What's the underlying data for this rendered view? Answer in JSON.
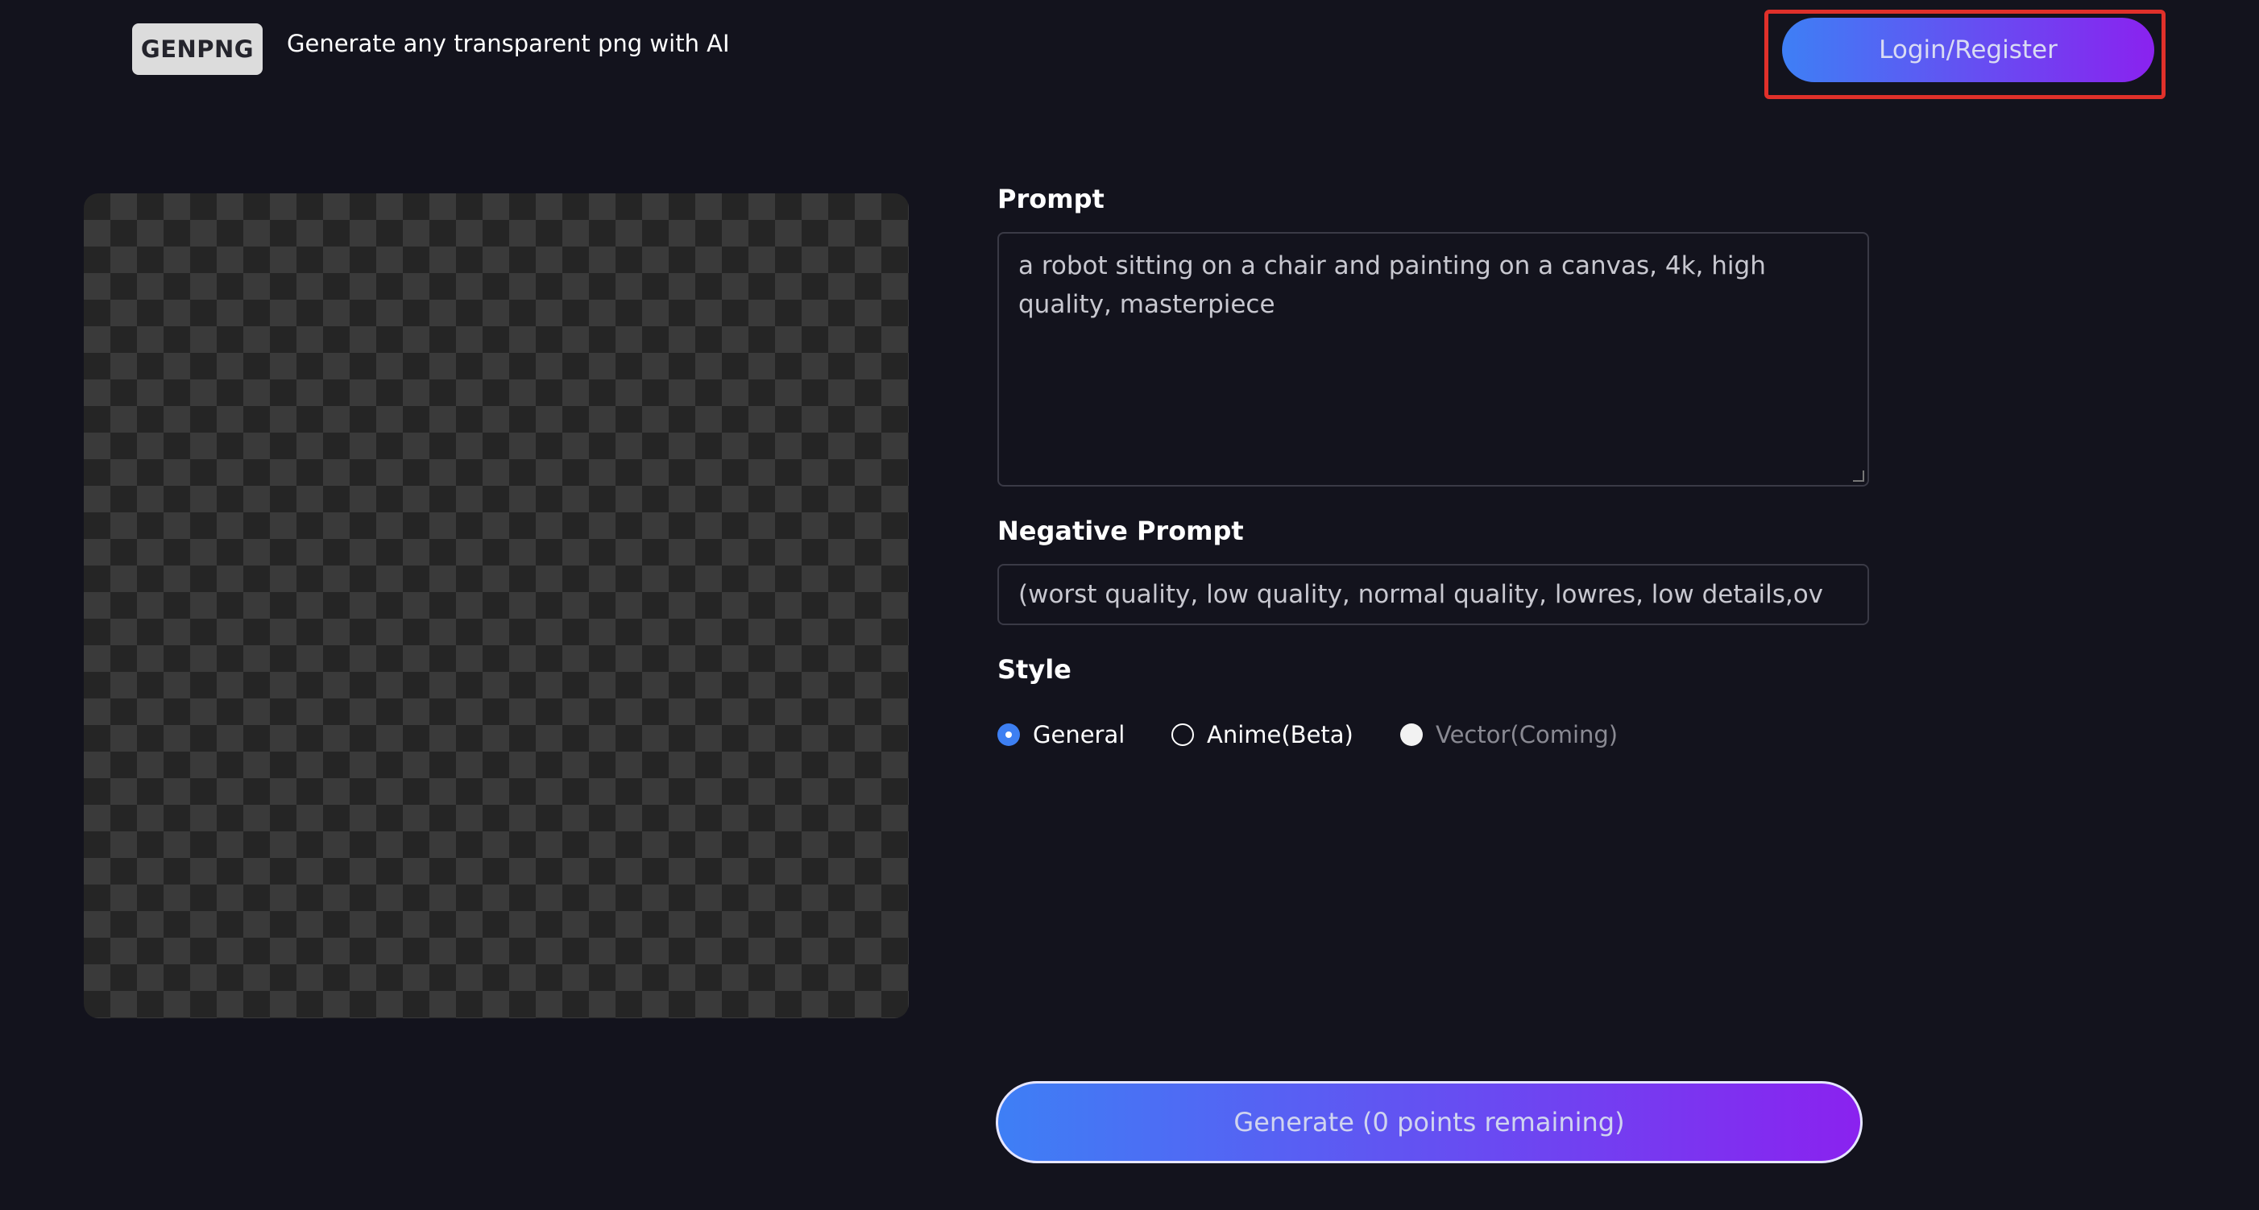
{
  "header": {
    "logo_text": "GENPNG",
    "tagline": "Generate any transparent png with AI",
    "login_label": "Login/Register"
  },
  "preview": {
    "background": "transparent-checkerboard"
  },
  "form": {
    "prompt_label": "Prompt",
    "prompt_value": "a robot sitting on a chair and painting on a canvas, 4k, high quality, masterpiece",
    "negative_label": "Negative Prompt",
    "negative_value": "(worst quality, low quality, normal quality, lowres, low details,ov",
    "style_label": "Style",
    "style_options": [
      {
        "label": "General",
        "selected": true,
        "disabled": false
      },
      {
        "label": "Anime(Beta)",
        "selected": false,
        "disabled": false
      },
      {
        "label": "Vector(Coming)",
        "selected": false,
        "disabled": true
      }
    ],
    "generate_label": "Generate (0 points remaining)"
  },
  "colors": {
    "background": "#13131d",
    "accent_start": "#3e7ff5",
    "accent_end": "#8a22ef",
    "highlight": "#e0302a"
  }
}
